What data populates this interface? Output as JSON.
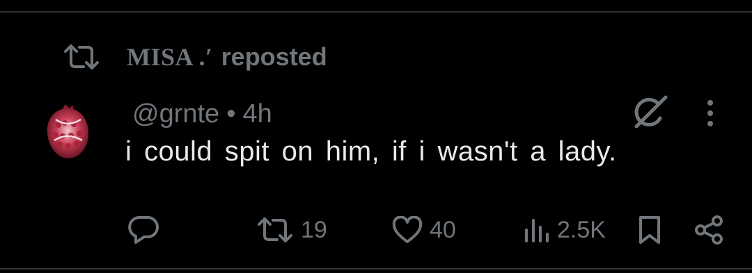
{
  "repost_header": {
    "icon": "repost-icon",
    "display_name": "MISA .′",
    "label": "reposted"
  },
  "tweet": {
    "avatar": "pomegranate-avatar",
    "handle": "@grnte",
    "separator": "•",
    "time": "4h",
    "text": "i could spit on him, if i wasn't a lady."
  },
  "actions": {
    "reply": {
      "icon": "reply-icon",
      "count": ""
    },
    "repost": {
      "icon": "repost-icon",
      "count": "19"
    },
    "like": {
      "icon": "heart-icon",
      "count": "40"
    },
    "views": {
      "icon": "views-icon",
      "count": "2.5K"
    },
    "bookmark": {
      "icon": "bookmark-icon"
    },
    "share": {
      "icon": "share-icon"
    }
  },
  "colors": {
    "background": "#000000",
    "text_primary": "#e7e9ea",
    "text_secondary": "#71767b",
    "divider": "#2f3336"
  }
}
